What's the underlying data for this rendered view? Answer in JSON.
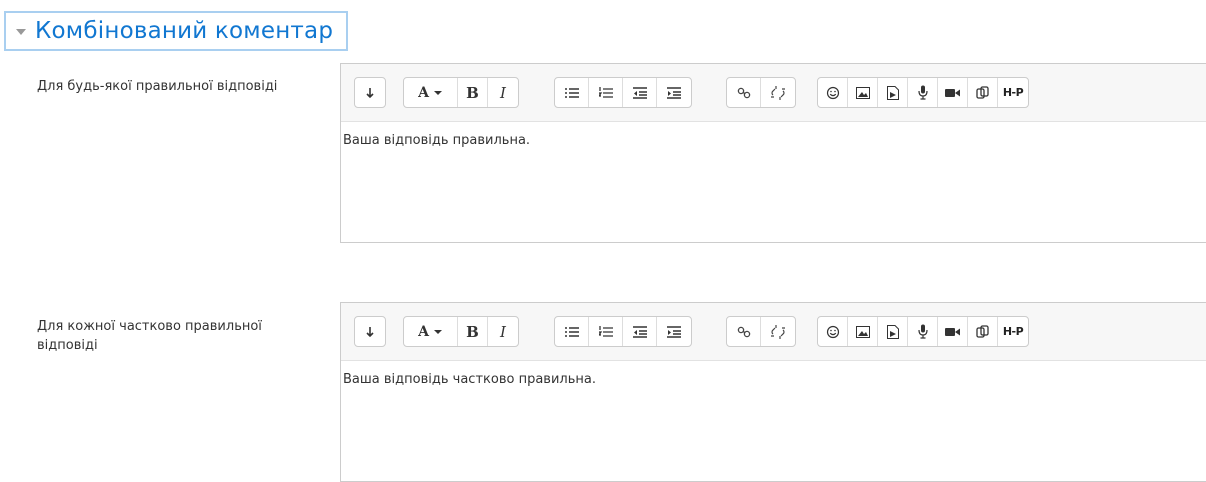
{
  "section": {
    "title": "Комбінований коментар"
  },
  "fields": [
    {
      "label": "Для будь-якої правильної відповіді",
      "value": "Ваша відповідь правильна."
    },
    {
      "label": "Для кожної частково правильної відповіді",
      "value": "Ваша відповідь частково правильна."
    }
  ],
  "toolbar": {
    "font_label": "A",
    "bold_label": "B",
    "italic_label": "I",
    "h5p_label": "H-P"
  },
  "colors": {
    "accent": "#1177d1",
    "header_border": "#a9cff0",
    "toolbar_bg": "#f7f7f7"
  }
}
